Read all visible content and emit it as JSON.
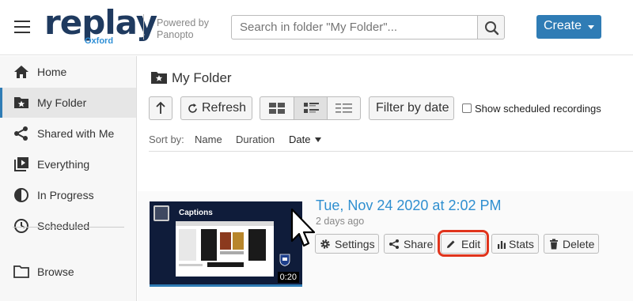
{
  "header": {
    "logo_main": "replay",
    "logo_sub": "Oxford",
    "powered_by": "Powered by",
    "powered_brand": "Panopto",
    "search_placeholder": "Search in folder \"My Folder\"...",
    "create_label": "Create"
  },
  "sidebar": {
    "items": [
      {
        "label": "Home",
        "icon": "home-icon"
      },
      {
        "label": "My Folder",
        "icon": "folder-star-icon",
        "active": true
      },
      {
        "label": "Shared with Me",
        "icon": "share-icon"
      },
      {
        "label": "Everything",
        "icon": "play-stack-icon"
      },
      {
        "label": "In Progress",
        "icon": "progress-icon"
      },
      {
        "label": "Scheduled",
        "icon": "clock-icon"
      },
      {
        "label": "Browse",
        "icon": "folder-icon"
      }
    ]
  },
  "main": {
    "folder_title": "My Folder",
    "toolbar": {
      "refresh_label": "Refresh",
      "filter_label": "Filter by date",
      "show_scheduled_label": "Show scheduled recordings",
      "show_scheduled_checked": false,
      "view_mode_selected": "detailed"
    },
    "sort": {
      "label": "Sort by:",
      "options": [
        "Name",
        "Duration",
        "Date"
      ],
      "active": "Date"
    },
    "sessions": [
      {
        "title": "Tue, Nov 24 2020 at 2:02 PM",
        "age": "2 days ago",
        "thumb_caption": "Captions",
        "duration": "0:20",
        "actions": [
          "Settings",
          "Share",
          "Edit",
          "Stats",
          "Delete"
        ],
        "highlighted_action": "Edit"
      }
    ]
  },
  "colors": {
    "accent": "#2f7cb5",
    "title_link": "#2f8fd0",
    "highlight": "#e0341c",
    "logo_dark": "#1f3a5f",
    "logo_light": "#2e8fd6"
  }
}
